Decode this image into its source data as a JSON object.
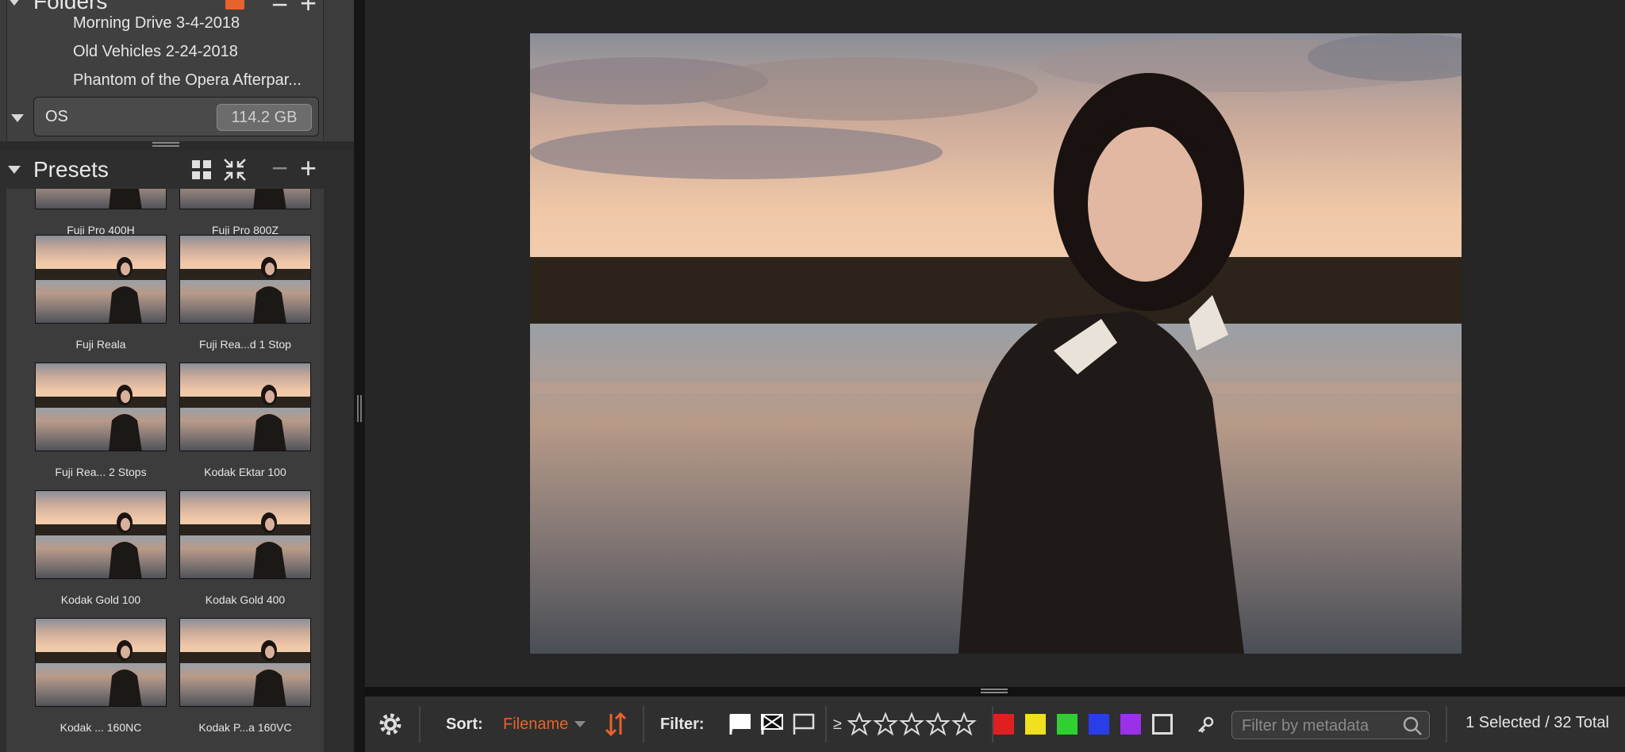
{
  "folders": {
    "title": "Folders",
    "items": [
      {
        "label": "Morning Drive 3-4-2018"
      },
      {
        "label": "Old Vehicles 2-24-2018"
      },
      {
        "label": "Phantom of the Opera Afterpar..."
      }
    ],
    "drive": {
      "label": "OS",
      "size": "114.2 GB"
    }
  },
  "presets": {
    "title": "Presets",
    "items": [
      {
        "label": "Fuji Pro 400H"
      },
      {
        "label": "Fuji Pro 800Z"
      },
      {
        "label": "Fuji Reala"
      },
      {
        "label": "Fuji Rea...d 1 Stop"
      },
      {
        "label": "Fuji Rea... 2 Stops"
      },
      {
        "label": "Kodak Ektar 100"
      },
      {
        "label": "Kodak Gold 100"
      },
      {
        "label": "Kodak Gold 400"
      },
      {
        "label": "Kodak ... 160NC"
      },
      {
        "label": "Kodak P...a 160VC"
      }
    ]
  },
  "toolbar": {
    "sort_label": "Sort:",
    "sort_value": "Filename",
    "filter_label": "Filter:",
    "rating_op": "≥",
    "color_labels": [
      "#e02020",
      "#f0e020",
      "#30d030",
      "#2a3ee8",
      "#9a30e8"
    ],
    "metadata_placeholder": "Filter by metadata",
    "status": "1 Selected / 32 Total"
  },
  "colors": {
    "accent": "#e8622c"
  }
}
